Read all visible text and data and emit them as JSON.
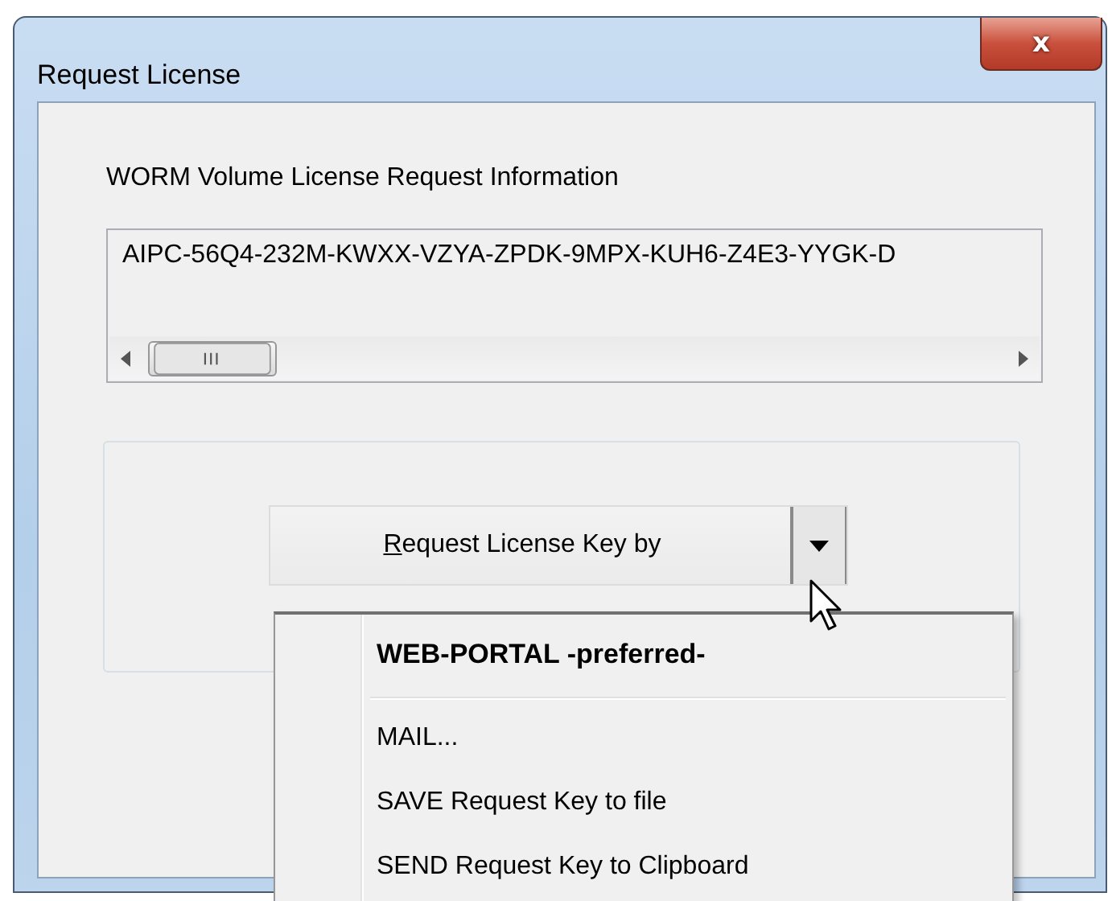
{
  "window": {
    "title": "Request License",
    "close_button": "x"
  },
  "request_info": {
    "label": "WORM Volume License Request Information",
    "key": "AIPC-56Q4-232M-KWXX-VZYA-ZPDK-9MPX-KUH6-Z4E3-YYGK-D"
  },
  "split_button": {
    "label": "Request License Key by",
    "mnemonic_underlined": true,
    "expanded": true
  },
  "menu": {
    "items": [
      {
        "kind": "item",
        "label": "WEB-PORTAL -preferred-",
        "default": true
      },
      {
        "kind": "separator"
      },
      {
        "kind": "item",
        "label": "MAIL...",
        "default": false
      },
      {
        "kind": "item",
        "label": "SAVE Request Key to file",
        "default": false
      },
      {
        "kind": "item",
        "label": "SEND Request Key to Clipboard",
        "default": false
      }
    ]
  }
}
